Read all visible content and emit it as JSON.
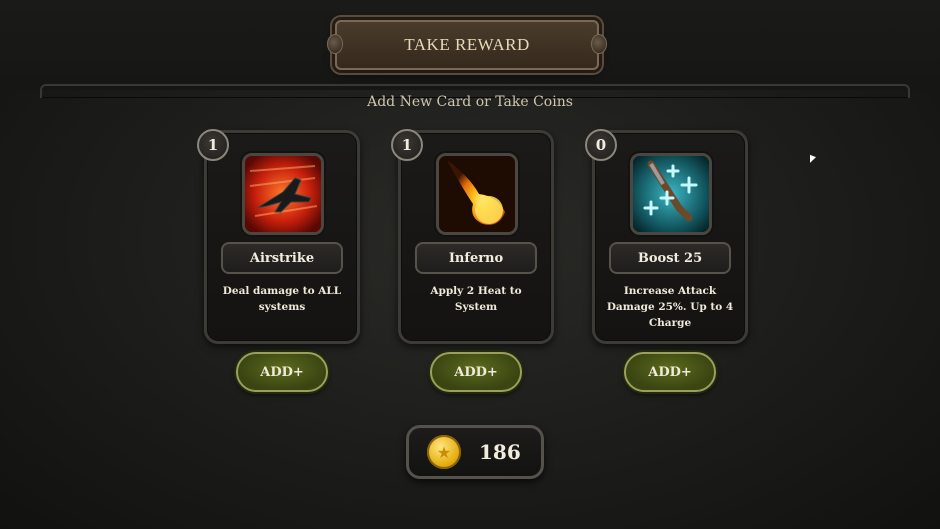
{
  "header": {
    "title": "TAKE REWARD"
  },
  "subtitle": "Add New Card or Take Coins",
  "cards": [
    {
      "count": "1",
      "name": "Airstrike",
      "description": "Deal damage to ALL systems",
      "icon": "jet-icon",
      "button": "ADD+"
    },
    {
      "count": "1",
      "name": "Inferno",
      "description": "Apply 2 Heat to System",
      "icon": "fireball-icon",
      "button": "ADD+"
    },
    {
      "count": "0",
      "name": "Boost 25",
      "description": "Increase Attack Damage 25%. Up to 4 Charge",
      "icon": "syringe-plus-icon",
      "button": "ADD+"
    }
  ],
  "coins": {
    "amount": "186",
    "icon": "coin-icon"
  },
  "colors": {
    "accent_green": "#4b5a16",
    "gold": "#e5ae12"
  }
}
